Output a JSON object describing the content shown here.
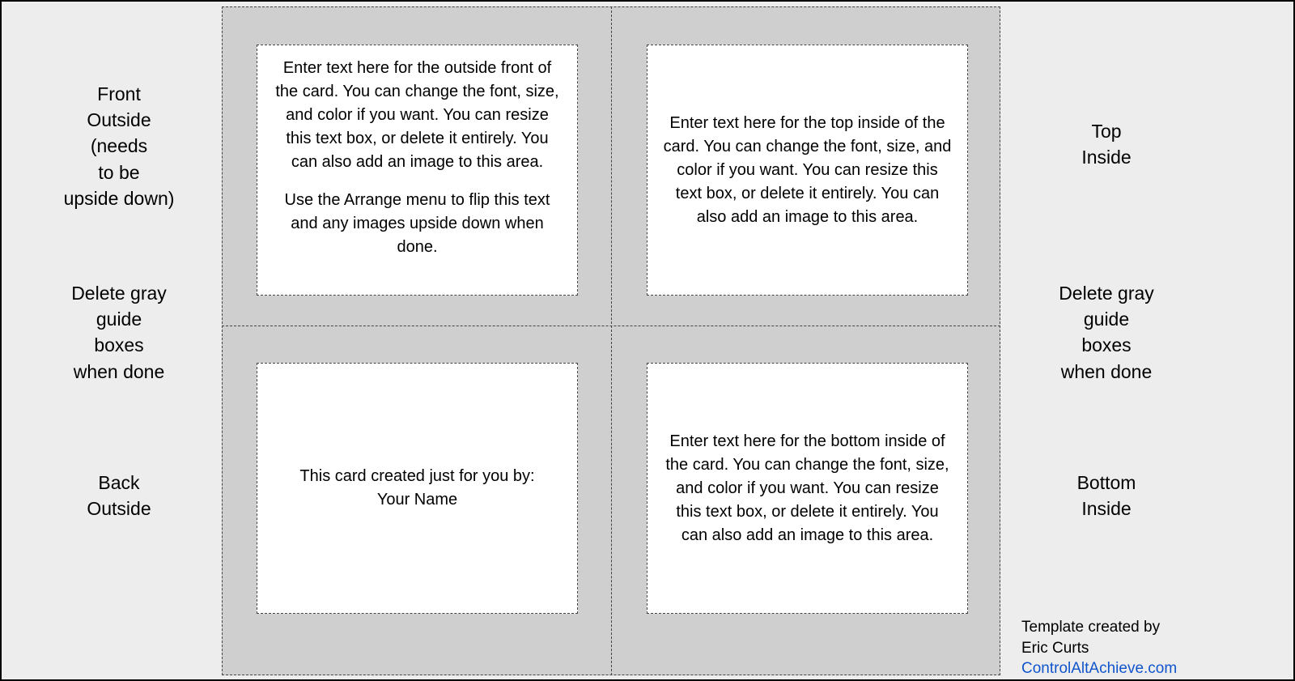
{
  "labels": {
    "front_outside": "Front\nOutside\n(needs\nto be\nupside down)",
    "delete_guide_left": "Delete gray\nguide\nboxes\nwhen done",
    "back_outside": "Back\nOutside",
    "top_inside": "Top\nInside",
    "delete_guide_right": "Delete gray\nguide\nboxes\nwhen done",
    "bottom_inside": "Bottom\nInside"
  },
  "boxes": {
    "front_outside_para1": "Enter text here for the outside front of the card. You can change the font, size, and color if you want. You can resize this text box, or delete it entirely. You can also add an image to this area.",
    "front_outside_para2": "Use the Arrange menu to flip this text and any images upside down when done.",
    "top_inside": "Enter text here for the top inside of the card. You can change the font, size, and color if you want. You can resize this text box, or delete it entirely. You can also add an image to this area.",
    "back_outside_line1": "This card created just for you by:",
    "back_outside_line2": "Your Name",
    "bottom_inside": "Enter text here for the bottom inside of the card. You can change the font, size, and color if you want. You can resize this text box, or delete it entirely. You can also add an image to this area."
  },
  "credit": {
    "line1": "Template created by",
    "line2": "Eric Curts",
    "link": "ControlAltAchieve.com"
  }
}
